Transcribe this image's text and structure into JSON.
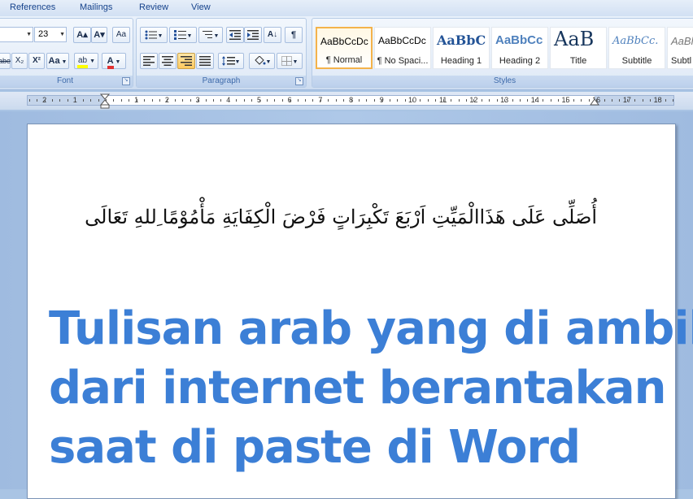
{
  "menu": [
    "References",
    "Mailings",
    "Review",
    "View"
  ],
  "font": {
    "size": "23",
    "group_label": "Font",
    "grow_icon": "A▴",
    "shrink_icon": "A▾",
    "clear_icon": "Aa",
    "strike_label": "abe",
    "subscript_label": "X₂",
    "superscript_label": "X²",
    "case_label": "Aa",
    "highlight_label": "ab",
    "color_label": "A",
    "highlight_color": "#ffff00",
    "font_color": "#e03030"
  },
  "paragraph": {
    "group_label": "Paragraph"
  },
  "styles": {
    "group_label": "Styles",
    "items": [
      {
        "preview": "AaBbCcDc",
        "name": "¶ Normal"
      },
      {
        "preview": "AaBbCcDc",
        "name": "¶ No Spaci..."
      },
      {
        "preview": "AaBbC",
        "name": "Heading 1"
      },
      {
        "preview": "AaBbCc",
        "name": "Heading 2"
      },
      {
        "preview": "AaB",
        "name": "Title"
      },
      {
        "preview": "AaBbCc.",
        "name": "Subtitle"
      },
      {
        "preview": "AaBl",
        "name": "Subtl"
      }
    ]
  },
  "ruler": {
    "numbers": [
      "2",
      "1",
      "1",
      "2",
      "3",
      "4",
      "5",
      "6",
      "7",
      "8",
      "9",
      "10",
      "11",
      "12",
      "13",
      "14",
      "15",
      "16",
      "17",
      "18"
    ]
  },
  "document": {
    "arabic_text": "أُصَلِّى عَلَى هَذَاالْمَيِّتِ اَرْبَعَ تَكْبِرَاتٍ فَرْضَ الْكِفَايَةِ مَأْمُوْمًا ِللهِ تَعَالَى",
    "overlay_lines": [
      "Tulisan arab yang di ambil",
      "dari internet berantakan",
      "saat di paste di Word"
    ]
  }
}
